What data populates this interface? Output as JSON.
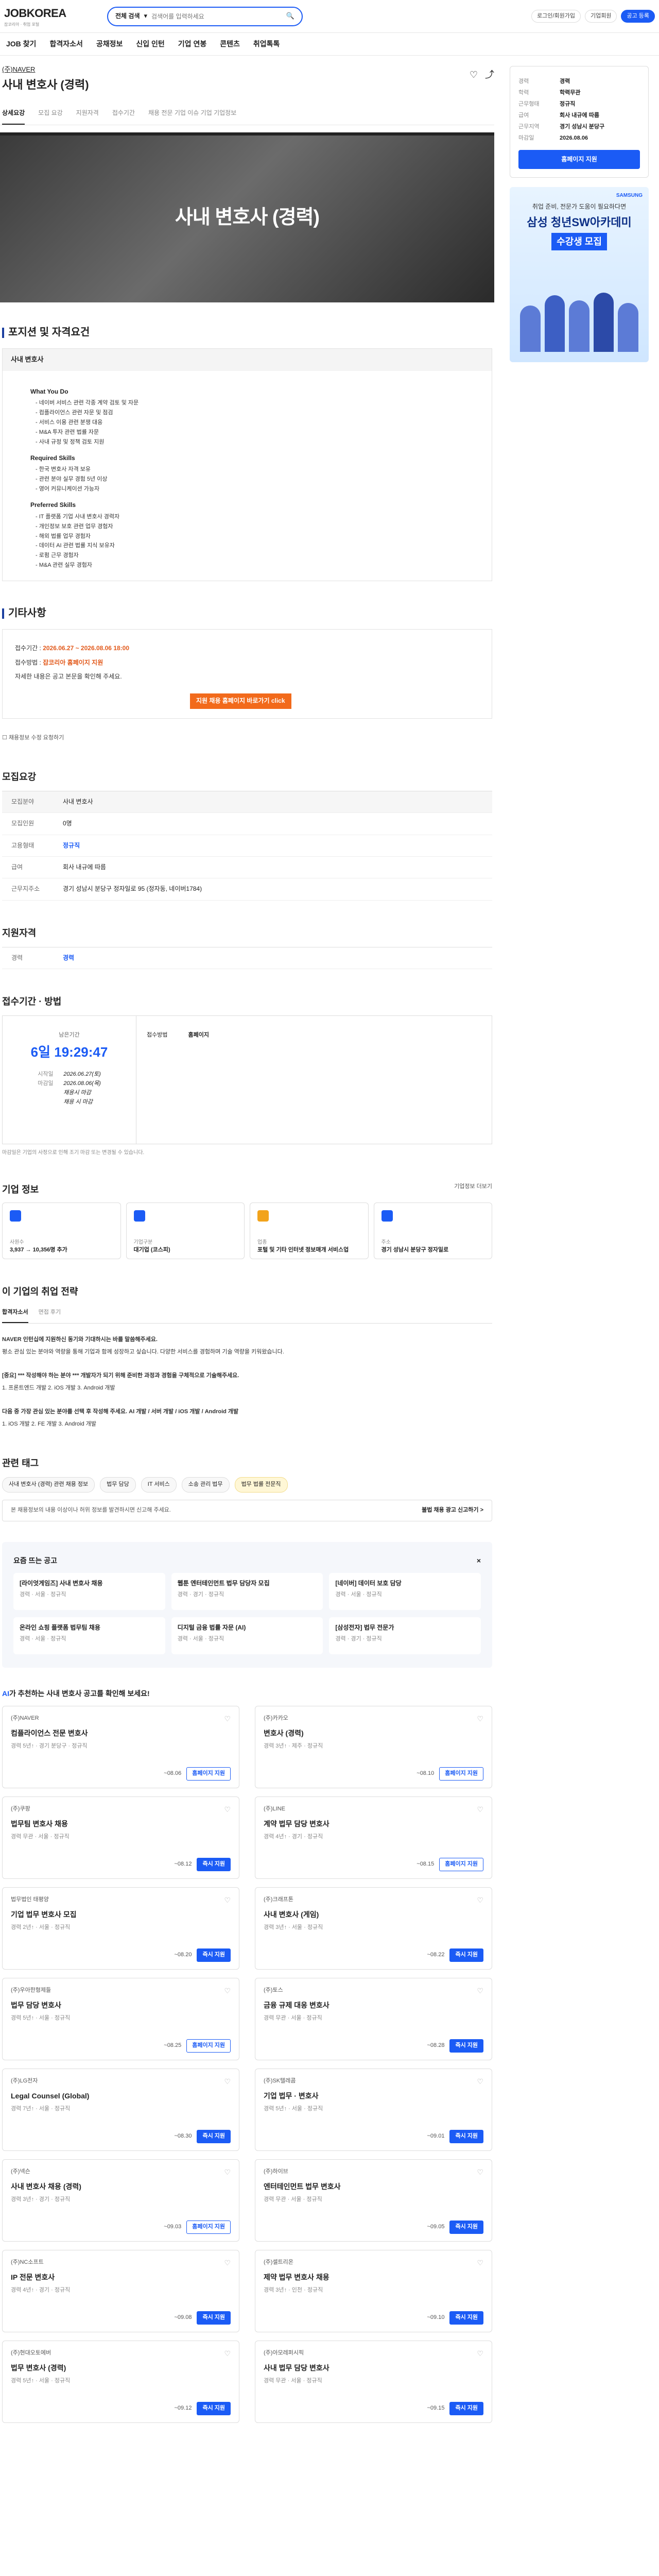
{
  "header": {
    "logo": "JOBKOREA",
    "logo_sub": "잡코리아 · 취업 포털",
    "search_scope": "전체 검색",
    "search_placeholder": "검색어를 입력하세요",
    "login": "로그인/회원가입",
    "enterprise": "기업회원",
    "btn_post": "공고 등록"
  },
  "gnb": [
    "JOB 찾기",
    "합격자소서",
    "공채정보",
    "신입 인턴",
    "기업 연봉",
    "콘텐츠",
    "취업톡톡"
  ],
  "job": {
    "company": "(주)NAVER",
    "title": "사내 변호사 (경력)",
    "hero_text": "사내 변호사 (경력)"
  },
  "tabs": [
    "상세요강",
    "모집 요강",
    "지원자격",
    "접수기간",
    "채용 전문 기업 이슈 기업 기업정보"
  ],
  "position": {
    "heading": "포지션 및 자격요건",
    "card_caption": "사내 변호사",
    "what_title": "What You Do",
    "what": [
      "네이버 서비스 관련 각종 계약 검토 및 자문",
      "컴플라이언스 관련 자문 및 점검",
      "서비스 이용 관련 분쟁 대응",
      "M&A 투자 관련 법률 자문",
      "사내 규정 및 정책 검토 지원"
    ],
    "req_title": "Required Skills",
    "req": [
      "한국 변호사 자격 보유",
      "관련 분야 실무 경험 5년 이상",
      "영어 커뮤니케이션 가능자"
    ],
    "pref_title": "Preferred Skills",
    "pref": [
      "IT 플랫폼 기업 사내 변호사 경력자",
      "개인정보 보호 관련 업무 경험자",
      "해외 법률 업무 경험자",
      "데이터 AI 관련 법률 지식 보유자",
      "로펌 근무 경험자",
      "M&A 관련 실무 경험자"
    ]
  },
  "etc": {
    "heading": "기타사항",
    "period_label": "접수기간 :",
    "period_value": "2026.06.27 ~ 2026.08.06 18:00",
    "apply_label": "접수방법 :",
    "apply_value": "잡코리아 홈페이지 지원",
    "note": "자세한 내용은 공고 본문을 확인해 주세요.",
    "cta": "지원 채용 홈페이지 바로가기 click",
    "check": "채용정보 수정 요청하기"
  },
  "recruit": {
    "heading": "모집요강",
    "head_k": "모집분야",
    "head_v": "사내 변호사",
    "rows": [
      {
        "k": "모집인원",
        "v": "0명"
      },
      {
        "k": "고용형태",
        "v": "정규직"
      },
      {
        "k": "급여",
        "v": "회사 내규에 따름"
      },
      {
        "k": "근무지주소",
        "v": "경기 성남시 분당구 정자일로 95 (정자동, 네이버1784)"
      }
    ]
  },
  "qual": {
    "heading": "지원자격",
    "k": "경력",
    "v": "경력"
  },
  "period": {
    "heading": "접수기간 · 방법",
    "remain": "남은기간",
    "big": "6일 19:29:47",
    "start_k": "시작일",
    "start_v": "2026.06.27(토)",
    "end_k": "마감일",
    "end_v": "2026.08.06(목)",
    "way_k": "접수방법",
    "way_v": "홈페이지",
    "extra1": "채용시 마감",
    "extra2": "채용 시 마감",
    "note": "마감일은 기업의 사정으로 인해 조기 마감 또는 변경될 수 있습니다."
  },
  "company": {
    "heading": "기업 정보",
    "more": "기업정보 더보기",
    "boxes": [
      {
        "lab": "사원수",
        "val": "3,937 → 10,356명 추가"
      },
      {
        "lab": "기업구분",
        "val": "대기업 (코스피)"
      },
      {
        "lab": "업종",
        "val": "포털 및 기타 인터넷 정보매개 서비스업"
      },
      {
        "lab": "주소",
        "val": "경기 성남시 분당구 정자일로"
      }
    ]
  },
  "hr": {
    "heading": "이 기업의 취업 전략",
    "tab1": "합격자소서",
    "tab2": "면접 후기",
    "p1": "NAVER 인턴십에 지원하신 동기와 기대하시는 바를 말씀해주세요.",
    "p2": "평소 관심 있는 분야와 역량을 통해 기업과 함께 성장하고 싶습니다. 다양한 서비스를 경험하며 기술 역량을 키워왔습니다.",
    "p3": "[중요] *** 작성해야 하는 분야 *** 개발자가 되기 위해 준비한 과정과 경험을 구체적으로 기술해주세요.",
    "p4": "1. 프론트엔드 개발 2. iOS 개발 3. Android 개발",
    "p5": "다음 중 가장 관심 있는 분야를 선택 후 작성해 주세요. AI 개발 / 서버 개발 / iOS 개발 / Android 개발",
    "p6": "1. iOS 개발 2. FE 개발 3. Android 개발"
  },
  "tags": {
    "heading": "관련 태그",
    "items": [
      "사내 변호사 (경력) 관련 채용 정보",
      "법무 담당",
      "IT 서비스",
      "소송 관리 법무",
      "법무 법률 전문직"
    ]
  },
  "report": {
    "text": "본 채용정보의 내용 이상이나 허위 정보를 발견하시면 신고해 주세요.",
    "link": "불법 채용 광고 신고하기 >"
  },
  "popular": {
    "heading": "요즘 뜨는 공고",
    "cards": [
      {
        "t": "[라이엇게임즈] 사내 변호사 채용",
        "m": "경력 · 서울 · 정규직"
      },
      {
        "t": "웹툰 엔터테인먼트 법무 담당자 모집",
        "m": "경력 · 경기 · 정규직"
      },
      {
        "t": "[네이버] 데이터 보호 담당",
        "m": "경력 · 서울 · 정규직"
      },
      {
        "t": "온라인 쇼핑 플랫폼 법무팀 채용",
        "m": "경력 · 서울 · 정규직"
      },
      {
        "t": "디지털 금융 법률 자문 (AI)",
        "m": "경력 · 서울 · 정규직"
      },
      {
        "t": "[삼성전자] 법무 전문가",
        "m": "경력 · 경기 · 정규직"
      }
    ]
  },
  "ai": {
    "brand": "AI",
    "rest": "가 추천하는 사내 변호사 공고를 확인해 보세요!",
    "jobs": [
      {
        "co": "(주)NAVER",
        "nm": "컴플라이언스 전문 변호사",
        "mt": "경력 5년↑ · 경기 분당구 · 정규직",
        "dday": "~08.06",
        "btn": "홈페이지 지원"
      },
      {
        "co": "(주)카카오",
        "nm": "변호사 (경력)",
        "mt": "경력 3년↑ · 제주 · 정규직",
        "dday": "~08.10",
        "btn": "홈페이지 지원"
      },
      {
        "co": "(주)쿠팡",
        "nm": "법무팀 변호사 채용",
        "mt": "경력 무관 · 서울 · 정규직",
        "dday": "~08.12",
        "btn": "즉시 지원"
      },
      {
        "co": "(주)LINE",
        "nm": "계약 법무 담당 변호사",
        "mt": "경력 4년↑ · 경기 · 정규직",
        "dday": "~08.15",
        "btn": "홈페이지 지원"
      },
      {
        "co": "법무법인 태평양",
        "nm": "기업 법무 변호사 모집",
        "mt": "경력 2년↑ · 서울 · 정규직",
        "dday": "~08.20",
        "btn": "즉시 지원"
      },
      {
        "co": "(주)크래프톤",
        "nm": "사내 변호사 (게임)",
        "mt": "경력 3년↑ · 서울 · 정규직",
        "dday": "~08.22",
        "btn": "즉시 지원"
      },
      {
        "co": "(주)우아한형제들",
        "nm": "법무 담당 변호사",
        "mt": "경력 5년↑ · 서울 · 정규직",
        "dday": "~08.25",
        "btn": "홈페이지 지원"
      },
      {
        "co": "(주)토스",
        "nm": "금융 규제 대응 변호사",
        "mt": "경력 무관 · 서울 · 정규직",
        "dday": "~08.28",
        "btn": "즉시 지원"
      },
      {
        "co": "(주)LG전자",
        "nm": "Legal Counsel (Global)",
        "mt": "경력 7년↑ · 서울 · 정규직",
        "dday": "~08.30",
        "btn": "즉시 지원"
      },
      {
        "co": "(주)SK텔레콤",
        "nm": "기업 법무 · 변호사",
        "mt": "경력 5년↑ · 서울 · 정규직",
        "dday": "~09.01",
        "btn": "즉시 지원"
      },
      {
        "co": "(주)넥슨",
        "nm": "사내 변호사 채용 (경력)",
        "mt": "경력 3년↑ · 경기 · 정규직",
        "dday": "~09.03",
        "btn": "홈페이지 지원"
      },
      {
        "co": "(주)하이브",
        "nm": "엔터테인먼트 법무 변호사",
        "mt": "경력 무관 · 서울 · 정규직",
        "dday": "~09.05",
        "btn": "즉시 지원"
      },
      {
        "co": "(주)NC소프트",
        "nm": "IP 전문 변호사",
        "mt": "경력 4년↑ · 경기 · 정규직",
        "dday": "~09.08",
        "btn": "즉시 지원"
      },
      {
        "co": "(주)셀트리온",
        "nm": "제약 법무 변호사 채용",
        "mt": "경력 3년↑ · 인천 · 정규직",
        "dday": "~09.10",
        "btn": "즉시 지원"
      },
      {
        "co": "(주)현대오토에버",
        "nm": "법무 변호사 (경력)",
        "mt": "경력 5년↑ · 서울 · 정규직",
        "dday": "~09.12",
        "btn": "즉시 지원"
      },
      {
        "co": "(주)아모레퍼시픽",
        "nm": "사내 법무 담당 변호사",
        "mt": "경력 무관 · 서울 · 정규직",
        "dday": "~09.15",
        "btn": "즉시 지원"
      }
    ]
  },
  "aside": {
    "rows": [
      {
        "k": "경력",
        "v": "경력"
      },
      {
        "k": "학력",
        "v": "학력무관"
      },
      {
        "k": "근무형태",
        "v": "정규직"
      },
      {
        "k": "급여",
        "v": "회사 내규에 따름"
      },
      {
        "k": "근무지역",
        "v": "경기 성남시 분당구"
      },
      {
        "k": "마감일",
        "v": "2026.08.06"
      }
    ],
    "go": "홈페이지 지원",
    "banner_brand": "SAMSUNG",
    "banner_t1": "취업 준비, 전문가 도움이 필요하다면",
    "banner_t2": "삼성 청년SW아카데미",
    "banner_t3": "수강생 모집"
  }
}
